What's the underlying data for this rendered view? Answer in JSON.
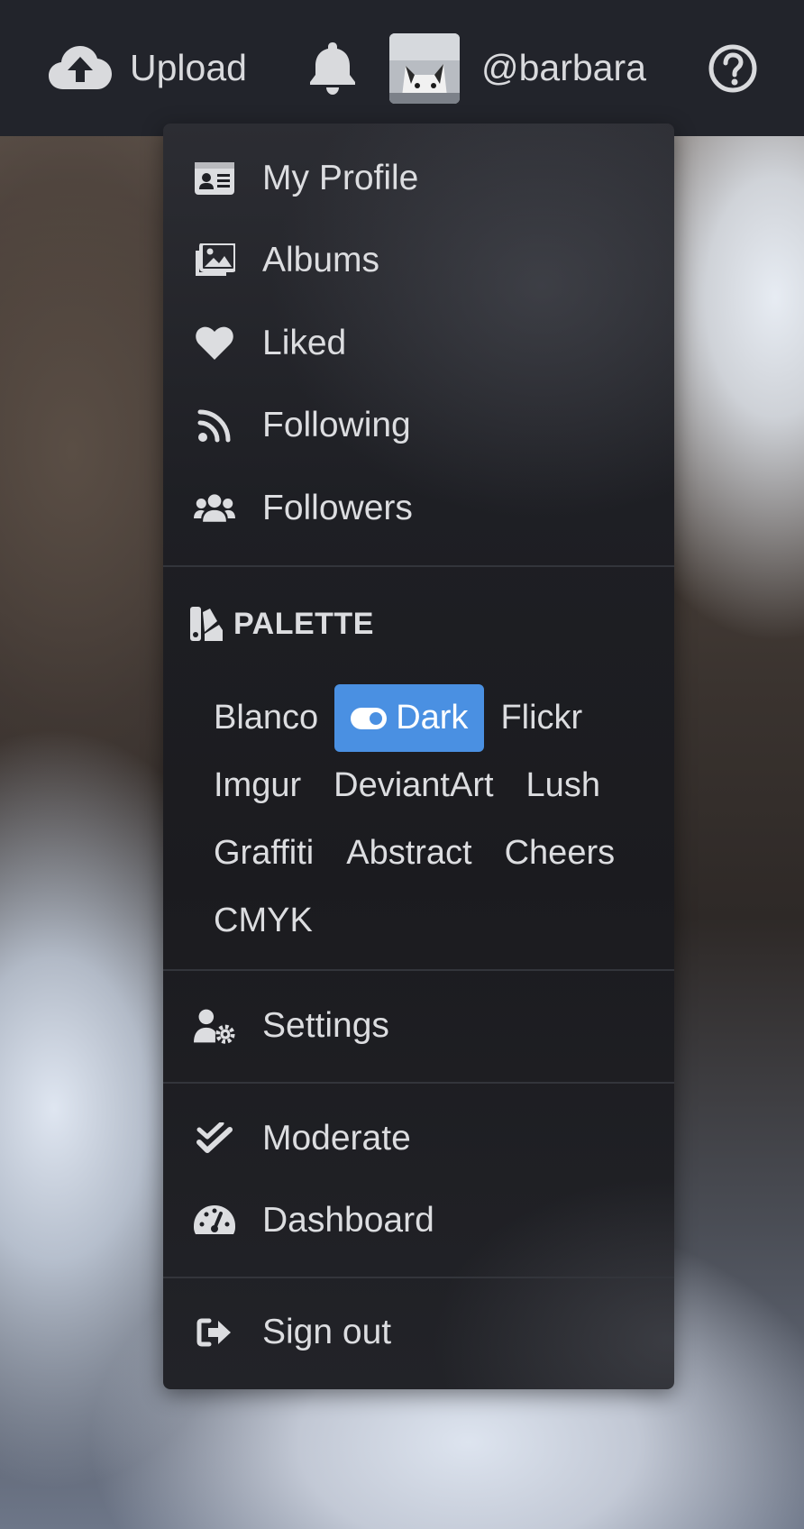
{
  "topbar": {
    "upload_label": "Upload",
    "username": "@barbara",
    "icons": {
      "upload": "cloud-upload-icon",
      "notifications": "bell-icon",
      "avatar": "avatar",
      "help": "question-circle-icon"
    }
  },
  "menu": {
    "items": [
      {
        "label": "My Profile",
        "icon": "id-card-icon"
      },
      {
        "label": "Albums",
        "icon": "images-icon"
      },
      {
        "label": "Liked",
        "icon": "heart-icon"
      },
      {
        "label": "Following",
        "icon": "rss-icon"
      },
      {
        "label": "Followers",
        "icon": "users-icon"
      }
    ],
    "palette": {
      "heading": "PALETTE",
      "icon": "swatchbook-icon",
      "options": [
        "Blanco",
        "Dark",
        "Flickr",
        "Imgur",
        "DeviantArt",
        "Lush",
        "Graffiti",
        "Abstract",
        "Cheers",
        "CMYK"
      ],
      "selected": "Dark",
      "selected_color": "#4a90e2"
    },
    "settings": {
      "label": "Settings",
      "icon": "user-cog-icon"
    },
    "admin": [
      {
        "label": "Moderate",
        "icon": "check-double-icon"
      },
      {
        "label": "Dashboard",
        "icon": "tachometer-icon"
      }
    ],
    "signout": {
      "label": "Sign out",
      "icon": "sign-out-icon"
    }
  }
}
